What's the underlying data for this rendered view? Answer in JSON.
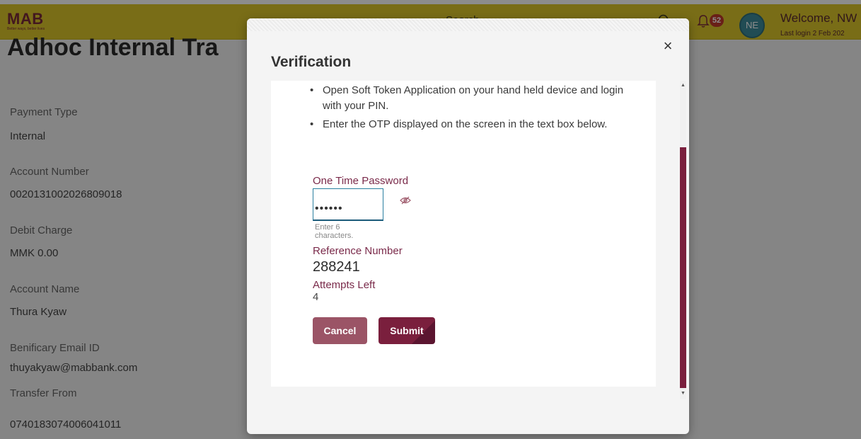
{
  "header": {
    "logo": "MAB",
    "logo_tagline": "Better ways, better lives",
    "search_placeholder": "Search",
    "notifications_count": "52",
    "avatar_initials": "NE",
    "welcome_text": "Welcome, NW",
    "last_login": "Last login 2 Feb 202",
    "colors": {
      "header_bg": "#dcc72a",
      "brand": "#7a2a3a",
      "badge": "#c0392b",
      "avatar": "#3c8b9a"
    }
  },
  "page": {
    "title": "Adhoc Internal Tra",
    "fields": [
      {
        "label": "Payment Type",
        "value": "Internal"
      },
      {
        "label": "Account Number",
        "value": "0020131002026809018"
      },
      {
        "label": "Debit Charge",
        "value": "MMK 0.00"
      },
      {
        "label": "Account Name",
        "value": "Thura Kyaw"
      },
      {
        "label": "Benificary Email ID",
        "value": "thuyakyaw@mabbank.com"
      },
      {
        "label": "Transfer From",
        "value": "0740183074006041011"
      }
    ]
  },
  "modal": {
    "title": "Verification",
    "close_label": "×",
    "instructions": [
      "Open Soft Token Application on your hand held device and login with your PIN.",
      "Enter the OTP displayed on the screen in the text box below."
    ],
    "otp_label": "One Time Password",
    "otp_value": "••••••",
    "otp_hint": "Enter 6 characters.",
    "reference_label": "Reference Number",
    "reference_value": "288241",
    "attempts_label": "Attempts Left",
    "attempts_value": "4",
    "cancel_label": "Cancel",
    "submit_label": "Submit",
    "colors": {
      "primary": "#7a1f3d",
      "secondary": "#9b5466",
      "label": "#7a2a4a"
    }
  }
}
